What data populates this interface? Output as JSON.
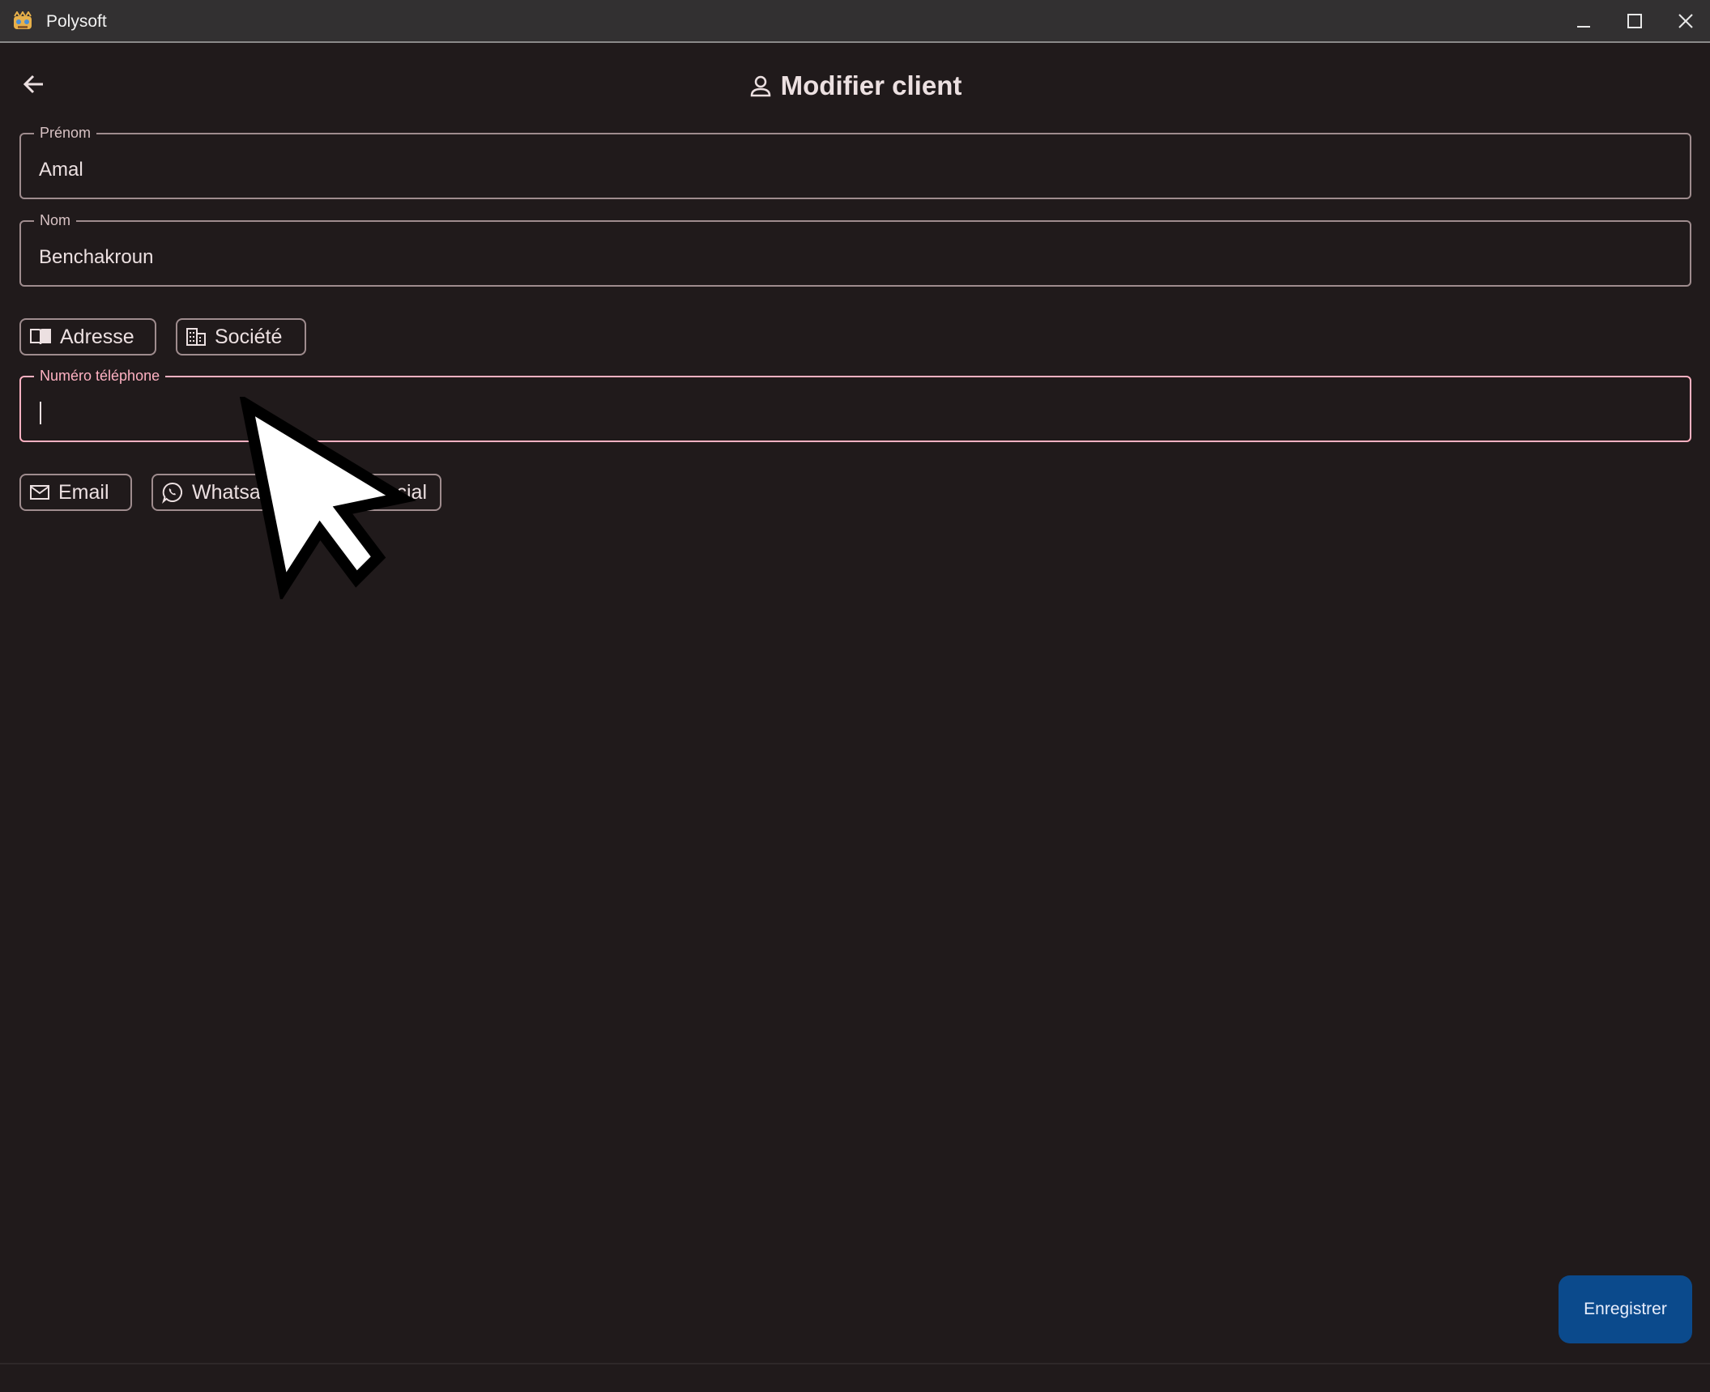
{
  "window": {
    "title": "Polysoft",
    "controls": [
      "minimize",
      "maximize",
      "close"
    ]
  },
  "header": {
    "title": "Modifier client",
    "back_icon": "arrow-left-icon",
    "title_icon": "person-icon"
  },
  "form": {
    "first_name": {
      "label": "Prénom",
      "value": "Amal"
    },
    "last_name": {
      "label": "Nom",
      "value": "Benchakroun"
    },
    "chips_row1": [
      {
        "label": "Adresse",
        "icon": "book-icon"
      },
      {
        "label": "Société",
        "icon": "building-icon"
      }
    ],
    "phone": {
      "label": "Numéro téléphone",
      "value": "",
      "focused": true
    },
    "chips_row2": [
      {
        "label": "Email",
        "icon": "mail-icon"
      },
      {
        "label": "Whatsa",
        "icon": "whatsapp-icon"
      },
      {
        "label": "Social",
        "icon": "social-icon"
      }
    ]
  },
  "actions": {
    "save_label": "Enregistrer"
  },
  "colors": {
    "background": "#201a1b",
    "focus_accent": "#ffb1c2",
    "primary_button": "#0b4a8c"
  }
}
